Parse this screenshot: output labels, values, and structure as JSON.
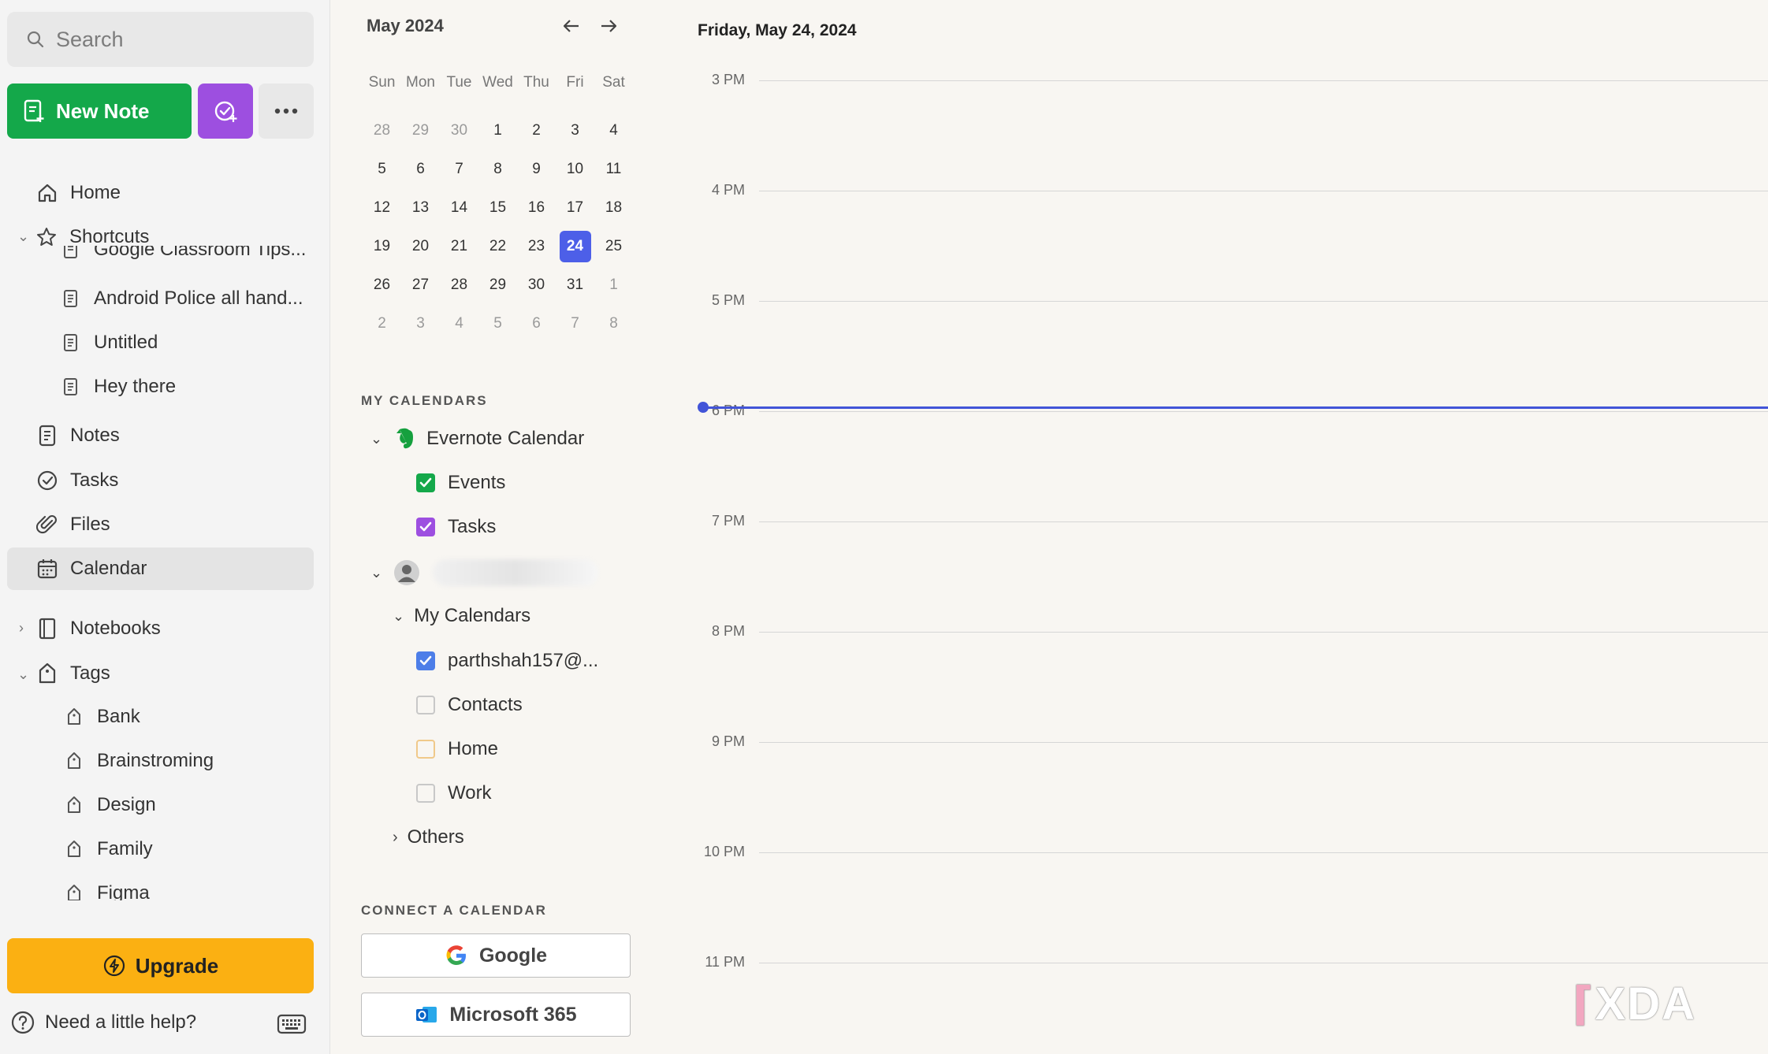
{
  "sidebar": {
    "search_placeholder": "Search",
    "new_note_label": "New Note",
    "nav": {
      "home": "Home",
      "shortcuts": "Shortcuts",
      "notes": "Notes",
      "tasks": "Tasks",
      "files": "Files",
      "calendar": "Calendar",
      "notebooks": "Notebooks",
      "tags": "Tags"
    },
    "shortcut_items": [
      "Google Classroom Tips...",
      "Android Police all hand...",
      "Untitled",
      "Hey there"
    ],
    "tag_items": [
      "Bank",
      "Brainstroming",
      "Design",
      "Family",
      "Figma"
    ],
    "upgrade_label": "Upgrade",
    "help_label": "Need a little help?"
  },
  "mini_calendar": {
    "month_label": "May 2024",
    "weekdays": [
      "Sun",
      "Mon",
      "Tue",
      "Wed",
      "Thu",
      "Fri",
      "Sat"
    ],
    "weeks": [
      [
        "28",
        "29",
        "30",
        "1",
        "2",
        "3",
        "4"
      ],
      [
        "5",
        "6",
        "7",
        "8",
        "9",
        "10",
        "11"
      ],
      [
        "12",
        "13",
        "14",
        "15",
        "16",
        "17",
        "18"
      ],
      [
        "19",
        "20",
        "21",
        "22",
        "23",
        "24",
        "25"
      ],
      [
        "26",
        "27",
        "28",
        "29",
        "30",
        "31",
        "1"
      ],
      [
        "2",
        "3",
        "4",
        "5",
        "6",
        "7",
        "8"
      ]
    ],
    "selected_day": "24"
  },
  "calendars": {
    "section_title": "MY CALENDARS",
    "evernote_calendar": "Evernote Calendar",
    "events": "Events",
    "tasks": "Tasks",
    "my_calendars": "My Calendars",
    "account_calendar": "parthshah157@...",
    "contacts": "Contacts",
    "home": "Home",
    "work": "Work",
    "others": "Others"
  },
  "connect": {
    "section_title": "CONNECT A CALENDAR",
    "google": "Google",
    "microsoft": "Microsoft 365"
  },
  "day_view": {
    "date_title": "Friday, May 24, 2024",
    "hours": [
      "3 PM",
      "4 PM",
      "5 PM",
      "6 PM",
      "7 PM",
      "8 PM",
      "9 PM",
      "10 PM",
      "11 PM"
    ]
  },
  "colors": {
    "accent_green": "#14a84a",
    "accent_purple": "#9d4fe0",
    "accent_blue": "#4d5fe8",
    "upgrade_yellow": "#fbb012"
  },
  "watermark": "XDA"
}
